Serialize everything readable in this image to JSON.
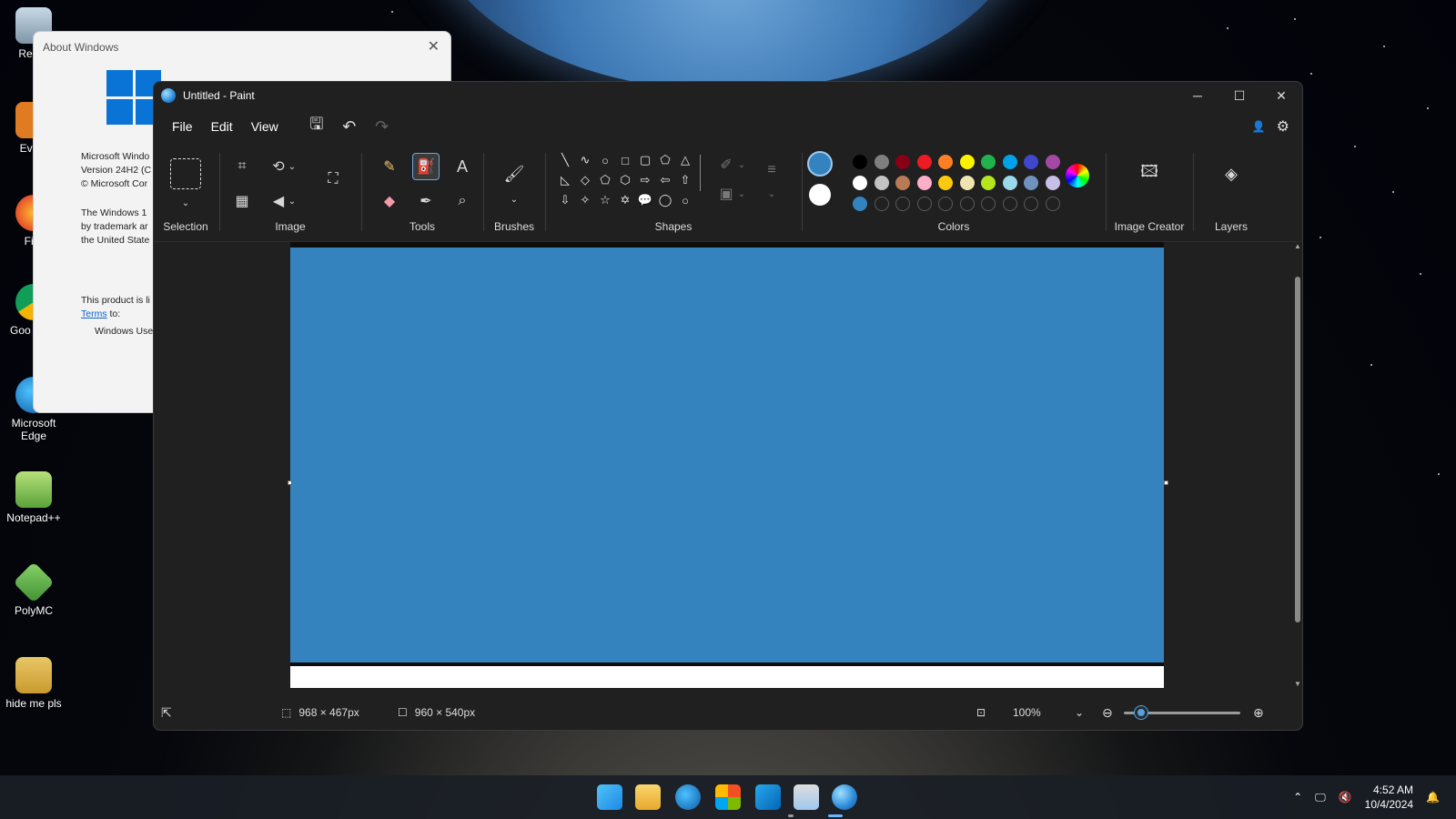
{
  "desktop": {
    "icons": [
      {
        "label": "Recyc",
        "icon": "recycle-bin-icon"
      },
      {
        "label": "Every",
        "icon": "everything-search-icon"
      },
      {
        "label": "Fire",
        "icon": "firefox-icon"
      },
      {
        "label": "Goo Chro",
        "icon": "chrome-icon"
      },
      {
        "label": "Microsoft Edge",
        "icon": "edge-icon"
      },
      {
        "label": "Notepad++",
        "icon": "notepadpp-icon"
      },
      {
        "label": "PolyMC",
        "icon": "polymc-icon"
      },
      {
        "label": "hide me pls",
        "icon": "folder-icon"
      }
    ]
  },
  "about_window": {
    "title": "About Windows",
    "lines": [
      "Microsoft Windo",
      "Version 24H2 (C",
      "© Microsoft Cor"
    ],
    "para1": [
      "The Windows 1",
      "by trademark ar",
      "the United State"
    ],
    "para2": "This product is li",
    "terms_link": "Terms",
    "terms_suffix": "to:",
    "user": "Windows Use"
  },
  "paint": {
    "title": "Untitled - Paint",
    "menu": {
      "file": "File",
      "edit": "Edit",
      "view": "View"
    },
    "groups": {
      "selection": "Selection",
      "image": "Image",
      "tools": "Tools",
      "brushes": "Brushes",
      "shapes": "Shapes",
      "colors": "Colors",
      "image_creator": "Image Creator",
      "layers": "Layers"
    },
    "colors": {
      "primary": "#3483bf",
      "secondary": "#ffffff",
      "row1": [
        "#000000",
        "#7f7f7f",
        "#880015",
        "#ed1c24",
        "#ff7f27",
        "#fff200",
        "#22b14c",
        "#00a2e8",
        "#3f48cc",
        "#a349a4"
      ],
      "row2": [
        "#ffffff",
        "#c3c3c3",
        "#b97a57",
        "#ffaec9",
        "#ffc90e",
        "#efe4b0",
        "#b5e61d",
        "#99d9ea",
        "#7092be",
        "#c8bfe7"
      ],
      "row3_first": "#3483bf"
    },
    "status": {
      "selection_size": "968 × 467px",
      "canvas_size": "960 × 540px",
      "zoom": "100%",
      "zoom_level": 0.15
    }
  },
  "taskbar": {
    "time": "4:52 AM",
    "date": "10/4/2024"
  }
}
